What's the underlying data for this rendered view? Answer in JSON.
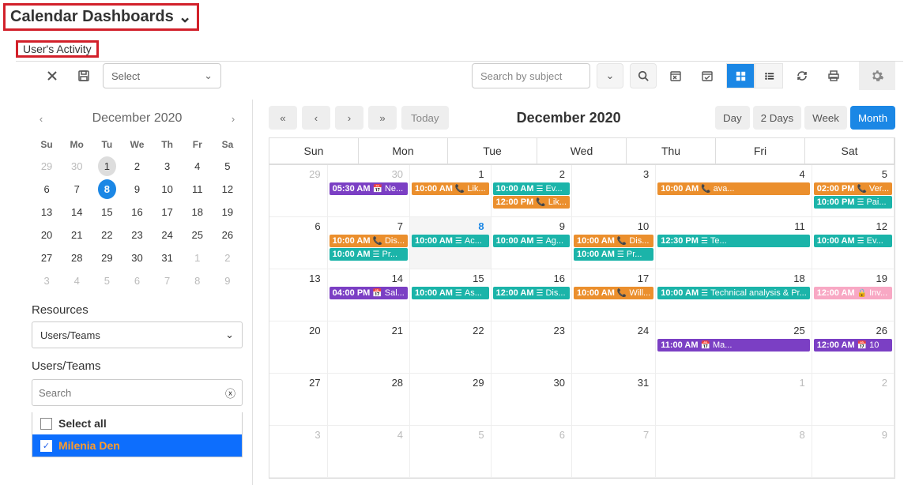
{
  "page": {
    "title": "Calendar Dashboards",
    "tab": "User's Activity"
  },
  "toolbar": {
    "select_placeholder": "Select",
    "search_placeholder": "Search by subject"
  },
  "mini_calendar": {
    "title": "December 2020",
    "day_headers": [
      "Su",
      "Mo",
      "Tu",
      "We",
      "Th",
      "Fr",
      "Sa"
    ],
    "cells": [
      {
        "d": "29",
        "dim": true
      },
      {
        "d": "30",
        "dim": true
      },
      {
        "d": "1",
        "today": true
      },
      {
        "d": "2"
      },
      {
        "d": "3"
      },
      {
        "d": "4"
      },
      {
        "d": "5"
      },
      {
        "d": "6"
      },
      {
        "d": "7"
      },
      {
        "d": "8",
        "selected": true
      },
      {
        "d": "9"
      },
      {
        "d": "10"
      },
      {
        "d": "11"
      },
      {
        "d": "12"
      },
      {
        "d": "13"
      },
      {
        "d": "14"
      },
      {
        "d": "15"
      },
      {
        "d": "16"
      },
      {
        "d": "17"
      },
      {
        "d": "18"
      },
      {
        "d": "19"
      },
      {
        "d": "20"
      },
      {
        "d": "21"
      },
      {
        "d": "22"
      },
      {
        "d": "23"
      },
      {
        "d": "24"
      },
      {
        "d": "25"
      },
      {
        "d": "26"
      },
      {
        "d": "27"
      },
      {
        "d": "28"
      },
      {
        "d": "29"
      },
      {
        "d": "30"
      },
      {
        "d": "31"
      },
      {
        "d": "1",
        "dim": true
      },
      {
        "d": "2",
        "dim": true
      },
      {
        "d": "3",
        "dim": true
      },
      {
        "d": "4",
        "dim": true
      },
      {
        "d": "5",
        "dim": true
      },
      {
        "d": "6",
        "dim": true
      },
      {
        "d": "7",
        "dim": true
      },
      {
        "d": "8",
        "dim": true
      },
      {
        "d": "9",
        "dim": true
      }
    ]
  },
  "resources": {
    "title": "Resources",
    "dropdown_value": "Users/Teams"
  },
  "users_teams": {
    "title": "Users/Teams",
    "search_placeholder": "Search",
    "select_all_label": "Select all",
    "items": [
      {
        "name": "Milenia Den",
        "checked": true
      }
    ]
  },
  "calendar": {
    "today_label": "Today",
    "title": "December 2020",
    "views": [
      "Day",
      "2 Days",
      "Week",
      "Month"
    ],
    "active_view": "Month",
    "day_headers": [
      "Sun",
      "Mon",
      "Tue",
      "Wed",
      "Thu",
      "Fri",
      "Sat"
    ],
    "weeks": [
      [
        {
          "date": "29",
          "dim": true,
          "events": []
        },
        {
          "date": "30",
          "dim": true,
          "events": [
            {
              "time": "05:30 AM",
              "icon": "calendar",
              "title": "Ne...",
              "color": "purple"
            }
          ]
        },
        {
          "date": "1",
          "events": [
            {
              "time": "10:00 AM",
              "icon": "phone",
              "title": "Lik...",
              "color": "orange"
            }
          ]
        },
        {
          "date": "2",
          "events": [
            {
              "time": "10:00 AM",
              "icon": "list",
              "title": "Ev...",
              "color": "teal"
            },
            {
              "time": "12:00 PM",
              "icon": "phone",
              "title": "Lik...",
              "color": "orange"
            }
          ]
        },
        {
          "date": "3",
          "events": []
        },
        {
          "date": "4",
          "events": [
            {
              "time": "10:00 AM",
              "icon": "phone",
              "title": "ava...",
              "color": "orange"
            }
          ]
        },
        {
          "date": "5",
          "events": [
            {
              "time": "02:00 PM",
              "icon": "phone",
              "title": "Ver...",
              "color": "orange"
            },
            {
              "time": "10:00 PM",
              "icon": "list",
              "title": "Pai...",
              "color": "teal"
            }
          ]
        }
      ],
      [
        {
          "date": "6",
          "events": []
        },
        {
          "date": "7",
          "events": [
            {
              "time": "10:00 AM",
              "icon": "phone",
              "title": "Dis...",
              "color": "orange"
            },
            {
              "time": "10:00 AM",
              "icon": "list",
              "title": "Pr...",
              "color": "teal"
            }
          ]
        },
        {
          "date": "8",
          "highlight": true,
          "blue": true,
          "events": [
            {
              "time": "10:00 AM",
              "icon": "list",
              "title": "Ac...",
              "color": "teal"
            }
          ]
        },
        {
          "date": "9",
          "events": [
            {
              "time": "10:00 AM",
              "icon": "list",
              "title": "Ag...",
              "color": "teal"
            }
          ]
        },
        {
          "date": "10",
          "events": [
            {
              "time": "10:00 AM",
              "icon": "phone",
              "title": "Dis...",
              "color": "orange"
            },
            {
              "time": "10:00 AM",
              "icon": "list",
              "title": "Pr...",
              "color": "teal"
            }
          ]
        },
        {
          "date": "11",
          "events": [
            {
              "time": "12:30 PM",
              "icon": "list",
              "title": "Te...",
              "color": "teal"
            }
          ]
        },
        {
          "date": "12",
          "events": [
            {
              "time": "10:00 AM",
              "icon": "list",
              "title": "Ev...",
              "color": "teal"
            }
          ]
        }
      ],
      [
        {
          "date": "13",
          "events": []
        },
        {
          "date": "14",
          "events": [
            {
              "time": "04:00 PM",
              "icon": "calendar",
              "title": "Sal...",
              "color": "purple"
            }
          ]
        },
        {
          "date": "15",
          "events": [
            {
              "time": "10:00 AM",
              "icon": "list",
              "title": "As...",
              "color": "teal"
            }
          ]
        },
        {
          "date": "16",
          "events": [
            {
              "time": "12:00 AM",
              "icon": "list",
              "title": "Dis...",
              "color": "teal"
            }
          ]
        },
        {
          "date": "17",
          "events": [
            {
              "time": "10:00 AM",
              "icon": "phone",
              "title": "Will...",
              "color": "orange"
            }
          ]
        },
        {
          "date": "18",
          "colspan": 2,
          "events": [
            {
              "time": "10:00 AM",
              "icon": "list",
              "title": "Technical analysis & Pr...",
              "color": "teal",
              "span": true
            }
          ]
        },
        {
          "date": "19",
          "events": [
            {
              "time": "12:00 AM",
              "icon": "lock",
              "title": "Inv...",
              "color": "pink"
            }
          ]
        }
      ],
      [
        {
          "date": "20",
          "events": []
        },
        {
          "date": "21",
          "events": []
        },
        {
          "date": "22",
          "events": []
        },
        {
          "date": "23",
          "events": []
        },
        {
          "date": "24",
          "events": []
        },
        {
          "date": "25",
          "events": [
            {
              "time": "11:00 AM",
              "icon": "calendar",
              "title": "Ma...",
              "color": "purple"
            }
          ]
        },
        {
          "date": "26",
          "events": [
            {
              "time": "12:00 AM",
              "icon": "calendar",
              "title": "10",
              "color": "purple"
            }
          ]
        }
      ],
      [
        {
          "date": "27",
          "events": []
        },
        {
          "date": "28",
          "events": []
        },
        {
          "date": "29",
          "events": []
        },
        {
          "date": "30",
          "events": []
        },
        {
          "date": "31",
          "events": []
        },
        {
          "date": "1",
          "dim": true,
          "events": []
        },
        {
          "date": "2",
          "dim": true,
          "events": []
        }
      ],
      [
        {
          "date": "3",
          "dim": true,
          "events": []
        },
        {
          "date": "4",
          "dim": true,
          "events": []
        },
        {
          "date": "5",
          "dim": true,
          "events": []
        },
        {
          "date": "6",
          "dim": true,
          "events": []
        },
        {
          "date": "7",
          "dim": true,
          "events": []
        },
        {
          "date": "8",
          "dim": true,
          "events": []
        },
        {
          "date": "9",
          "dim": true,
          "events": []
        }
      ]
    ]
  },
  "icons": {
    "phone": "📞",
    "calendar": "📅",
    "list": "☰",
    "lock": "🔒"
  }
}
